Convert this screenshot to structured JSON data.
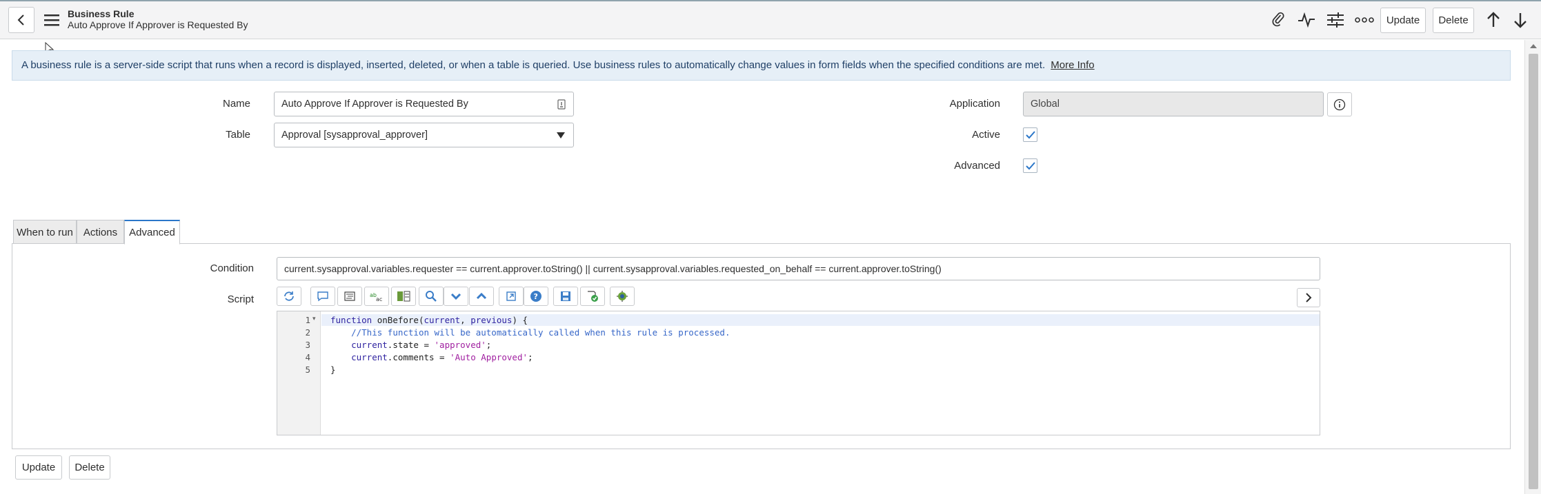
{
  "header": {
    "title": "Business Rule",
    "subtitle": "Auto Approve If Approver is Requested By",
    "update_label": "Update",
    "delete_label": "Delete"
  },
  "info": {
    "text": "A business rule is a server-side script that runs when a record is displayed, inserted, deleted, or when a table is queried. Use business rules to automatically change values in form fields when the specified conditions are met.",
    "link": "More Info"
  },
  "form": {
    "name_label": "Name",
    "name_value": "Auto Approve If Approver is Requested By",
    "table_label": "Table",
    "table_value": "Approval [sysapproval_approver]",
    "application_label": "Application",
    "application_value": "Global",
    "active_label": "Active",
    "active_checked": true,
    "advanced_label": "Advanced",
    "advanced_checked": true
  },
  "tabs": [
    {
      "label": "When to run"
    },
    {
      "label": "Actions"
    },
    {
      "label": "Advanced",
      "selected": true
    }
  ],
  "advanced": {
    "condition_label": "Condition",
    "condition_value": "current.sysapproval.variables.requester == current.approver.toString() || current.sysapproval.variables.requested_on_behalf == current.approver.toString()",
    "script_label": "Script",
    "lines": [
      "1",
      "2",
      "3",
      "4",
      "5"
    ]
  },
  "footer": {
    "update_label": "Update",
    "delete_label": "Delete"
  },
  "colors": {
    "accent": "#2a76c9",
    "info_bg": "#e6eff7",
    "tab_selected_border": "#2a76c9"
  }
}
